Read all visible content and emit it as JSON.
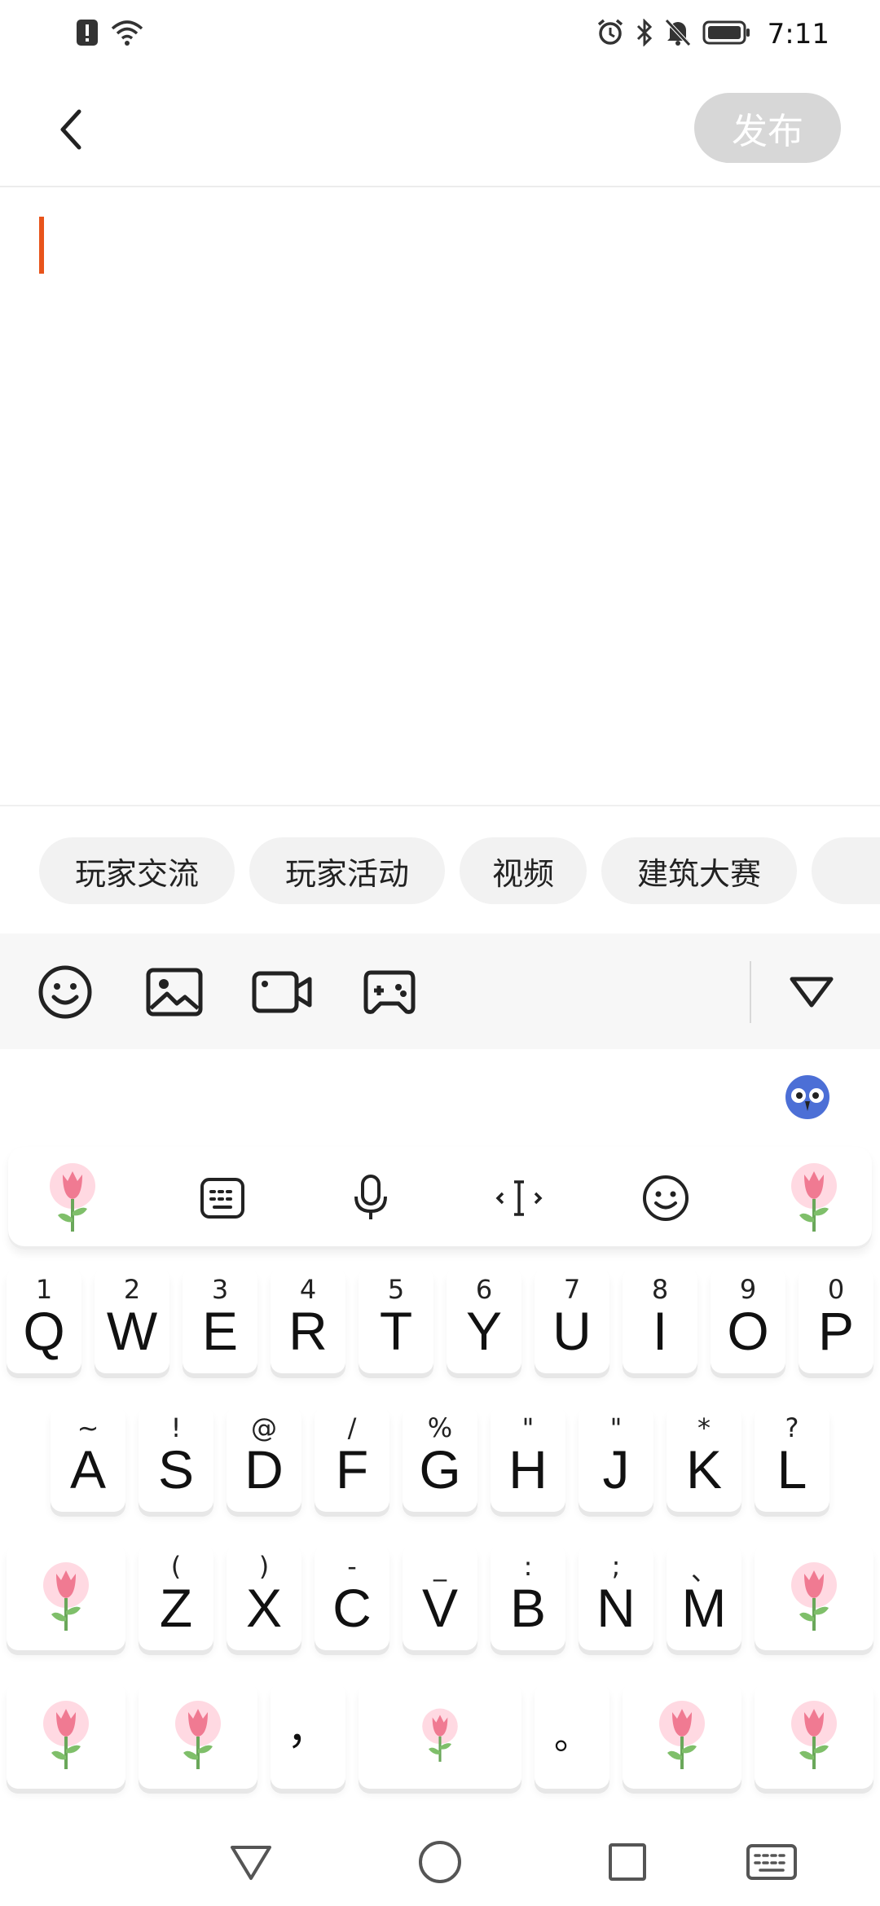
{
  "status_bar": {
    "time": "7:11",
    "left_icons": [
      "alert-icon",
      "wifi-icon"
    ],
    "right_icons": [
      "alarm-icon",
      "bluetooth-icon",
      "mute-icon",
      "battery-icon"
    ]
  },
  "header": {
    "publish_label": "发布"
  },
  "tags": [
    "玩家交流",
    "玩家活动",
    "视频",
    "建筑大赛"
  ],
  "toolbar": {
    "icons": [
      "emoji-icon",
      "image-icon",
      "video-camera-icon",
      "gamepad-icon",
      "collapse-triangle-icon"
    ]
  },
  "keyboard": {
    "row1": [
      {
        "main": "Q",
        "sub": "1"
      },
      {
        "main": "W",
        "sub": "2"
      },
      {
        "main": "E",
        "sub": "3"
      },
      {
        "main": "R",
        "sub": "4"
      },
      {
        "main": "T",
        "sub": "5"
      },
      {
        "main": "Y",
        "sub": "6"
      },
      {
        "main": "U",
        "sub": "7"
      },
      {
        "main": "I",
        "sub": "8"
      },
      {
        "main": "O",
        "sub": "9"
      },
      {
        "main": "P",
        "sub": "0"
      }
    ],
    "row2": [
      {
        "main": "A",
        "sub": "~"
      },
      {
        "main": "S",
        "sub": "!"
      },
      {
        "main": "D",
        "sub": "@"
      },
      {
        "main": "F",
        "sub": "/"
      },
      {
        "main": "G",
        "sub": "%"
      },
      {
        "main": "H",
        "sub": "\""
      },
      {
        "main": "J",
        "sub": "\""
      },
      {
        "main": "K",
        "sub": "*"
      },
      {
        "main": "L",
        "sub": "?"
      }
    ],
    "row3": [
      {
        "main": "Z",
        "sub": "("
      },
      {
        "main": "X",
        "sub": ")"
      },
      {
        "main": "C",
        "sub": "-"
      },
      {
        "main": "V",
        "sub": "_"
      },
      {
        "main": "B",
        "sub": ":"
      },
      {
        "main": "N",
        "sub": ";"
      },
      {
        "main": "M",
        "sub": "、"
      }
    ],
    "comma": "，",
    "period": "。"
  },
  "colors": {
    "accent_caret": "#e8541b",
    "publish_disabled": "#d7d7d7"
  }
}
